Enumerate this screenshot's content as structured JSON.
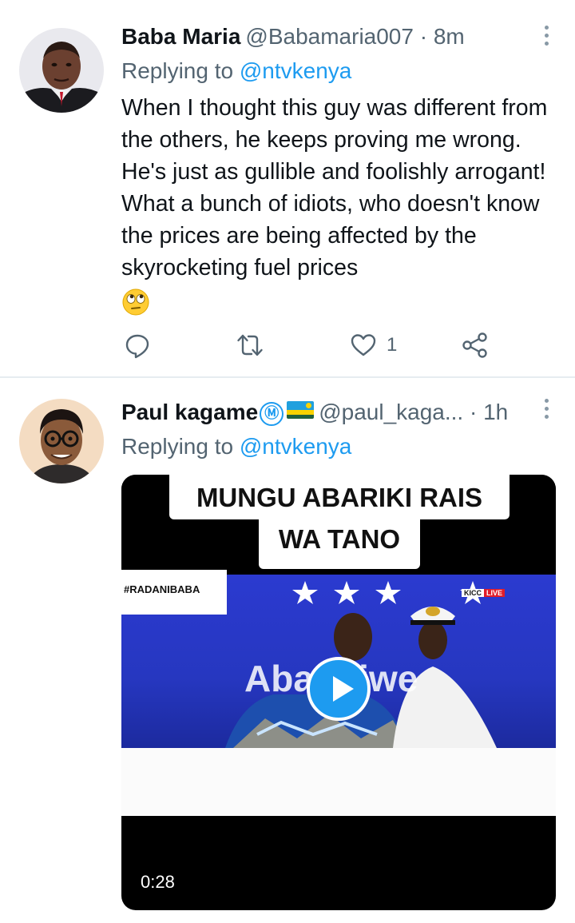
{
  "tweets": [
    {
      "name": "Baba Maria",
      "handle": "@Babamaria007",
      "separator": "·",
      "time": "8m",
      "replying_prefix": "Replying to",
      "replying_to": "@ntvkenya",
      "text": "When I thought this guy was different from the others, he keeps proving me wrong. He's just as gullible and foolishly arrogant! What a bunch of idiots, who doesn't know the prices are being affected by the skyrocketing fuel prices",
      "emoji": "face-with-rolling-eyes",
      "actions": {
        "reply_count": "",
        "retweet_count": "",
        "like_count": "1"
      }
    },
    {
      "name": "Paul kagame",
      "verified_glyph": "Ⓜ",
      "flag": "rwanda",
      "handle": "@paul_kaga...",
      "separator": "·",
      "time": "1h",
      "replying_prefix": "Replying to",
      "replying_to": "@ntvkenya",
      "video": {
        "caption_line1": "MUNGU ABARIKI RAIS",
        "caption_line2": "WA TANO",
        "hashtag": "#RADANIBABA",
        "tag_venue": "KICC",
        "tag_live": "LIVE",
        "overlay_text": "Abarikiwe",
        "duration": "0:28"
      }
    }
  ],
  "colors": {
    "accent": "#1d9bf0",
    "secondary_text": "#536471",
    "primary_text": "#0f1419",
    "divider": "#e6ecf0"
  },
  "icons": [
    "more-vertical-icon",
    "reply-icon",
    "retweet-icon",
    "like-icon",
    "share-icon",
    "play-icon"
  ]
}
